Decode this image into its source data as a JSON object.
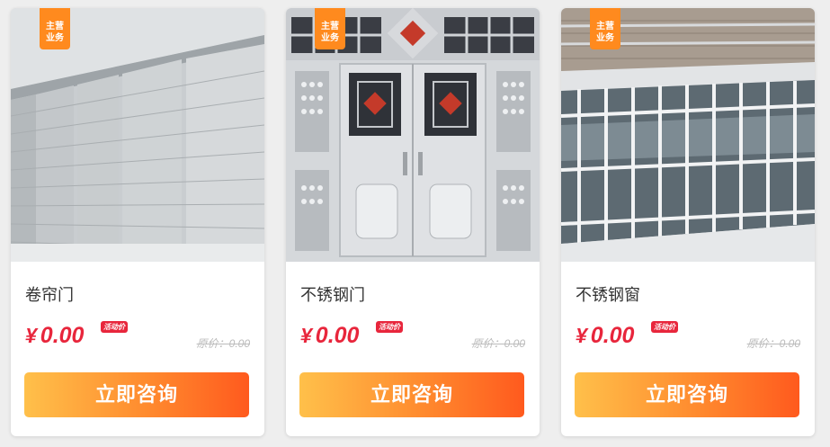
{
  "badge": {
    "line1": "主营",
    "line2": "业务"
  },
  "products": [
    {
      "title": "卷帘门",
      "currency": "¥",
      "price": "0.00",
      "price_tag": "活动价",
      "original_price": "原价：0.00",
      "button": "立即咨询",
      "image": "rolling-shutter-door-photo"
    },
    {
      "title": "不锈钢门",
      "currency": "¥",
      "price": "0.00",
      "price_tag": "活动价",
      "original_price": "原价：0.00",
      "button": "立即咨询",
      "image": "stainless-steel-door-photo"
    },
    {
      "title": "不锈钢窗",
      "currency": "¥",
      "price": "0.00",
      "price_tag": "活动价",
      "original_price": "原价：0.00",
      "button": "立即咨询",
      "image": "stainless-steel-window-photo"
    }
  ],
  "colors": {
    "price": "#e8263c",
    "badge": "#ff8a1e",
    "button_start": "#ffc04a",
    "button_end": "#ff5a1e"
  }
}
